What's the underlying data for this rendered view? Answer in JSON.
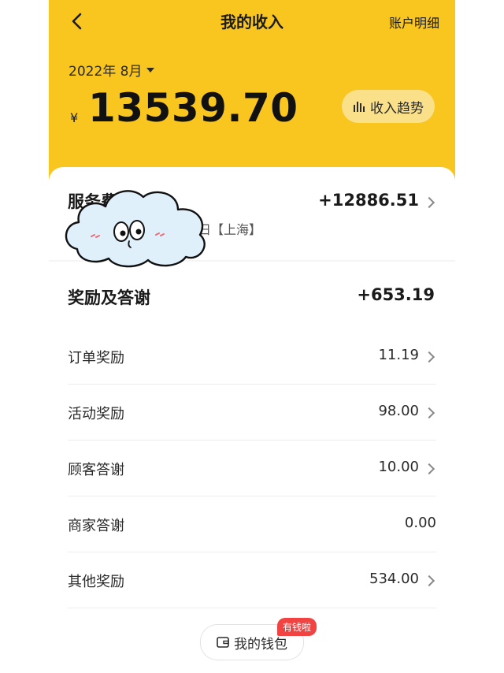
{
  "header": {
    "title": "我的收入",
    "right_link": "账户明细"
  },
  "summary": {
    "month": "2022年 8月",
    "currency": "¥",
    "amount": "13539.70",
    "trend_button": "收入趋势"
  },
  "service_fee": {
    "title": "服务费",
    "subtitle": "日【上海】",
    "amount": "+12886.51"
  },
  "rewards": {
    "title": "奖励及答谢",
    "amount": "+653.19",
    "items": [
      {
        "label": "订单奖励",
        "value": "11.19",
        "chevron": true
      },
      {
        "label": "活动奖励",
        "value": "98.00",
        "chevron": true
      },
      {
        "label": "顾客答谢",
        "value": "10.00",
        "chevron": true
      },
      {
        "label": "商家答谢",
        "value": "0.00",
        "chevron": false
      },
      {
        "label": "其他奖励",
        "value": "534.00",
        "chevron": true
      }
    ]
  },
  "wallet": {
    "label": "我的钱包",
    "badge": "有钱啦"
  },
  "colors": {
    "brand_yellow": "#f9c51f",
    "trend_button_bg": "#fbe08a",
    "badge_red": "#f24343"
  },
  "icons": [
    "back-arrow-icon",
    "dropdown-caret-icon",
    "bar-chart-icon",
    "chevron-right-icon",
    "wallet-icon",
    "cloud-sticker"
  ]
}
